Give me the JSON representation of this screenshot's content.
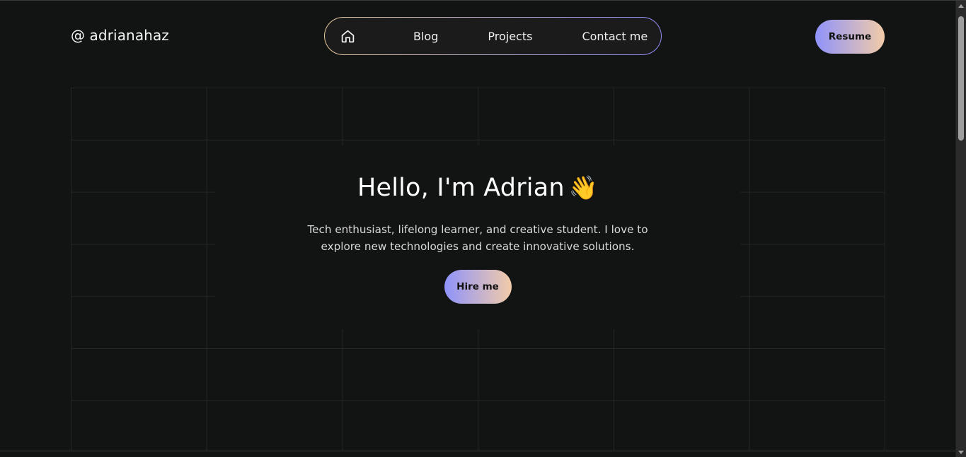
{
  "header": {
    "logo": "@ adrianahaz",
    "nav": {
      "home_icon": "home-icon",
      "links": [
        "Blog",
        "Projects",
        "Contact me"
      ]
    },
    "resume_label": "Resume"
  },
  "hero": {
    "title": "Hello, I'm Adrian",
    "emoji": "👋",
    "description": "Tech enthusiast, lifelong learner, and creative student. I love to explore new technologies and create innovative solutions.",
    "cta_label": "Hire me"
  },
  "colors": {
    "background": "#121313",
    "gradient_start": "#8f93fb",
    "gradient_end": "#f2cba8",
    "nav_border_start": "#e2c79a",
    "nav_border_end": "#8f8bf3"
  }
}
